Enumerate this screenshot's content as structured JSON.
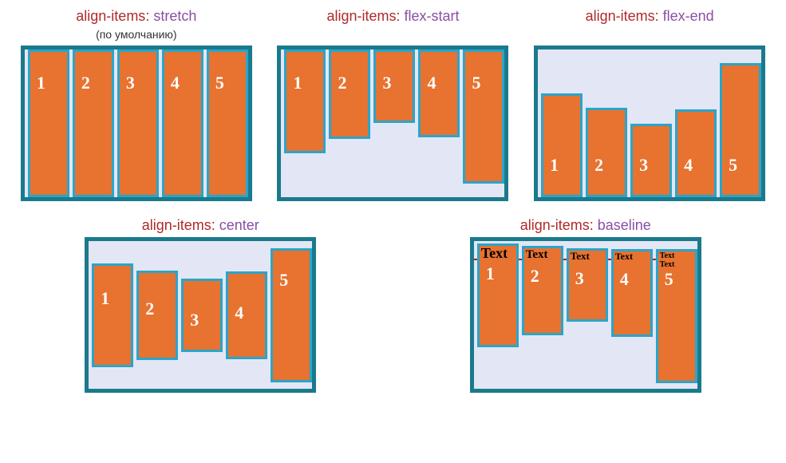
{
  "property_label": "align-items",
  "examples": {
    "stretch": {
      "value": "stretch",
      "subtitle": "(по умолчанию)",
      "items": [
        "1",
        "2",
        "3",
        "4",
        "5"
      ]
    },
    "flex_start": {
      "value": "flex-start",
      "items": [
        "1",
        "2",
        "3",
        "4",
        "5"
      ]
    },
    "flex_end": {
      "value": "flex-end",
      "items": [
        "1",
        "2",
        "3",
        "4",
        "5"
      ]
    },
    "center": {
      "value": "center",
      "items": [
        "1",
        "2",
        "3",
        "4",
        "5"
      ]
    },
    "baseline": {
      "value": "baseline",
      "items": [
        "1",
        "2",
        "3",
        "4",
        "5"
      ],
      "text_label": "Text",
      "item5_line2": "Text"
    }
  }
}
